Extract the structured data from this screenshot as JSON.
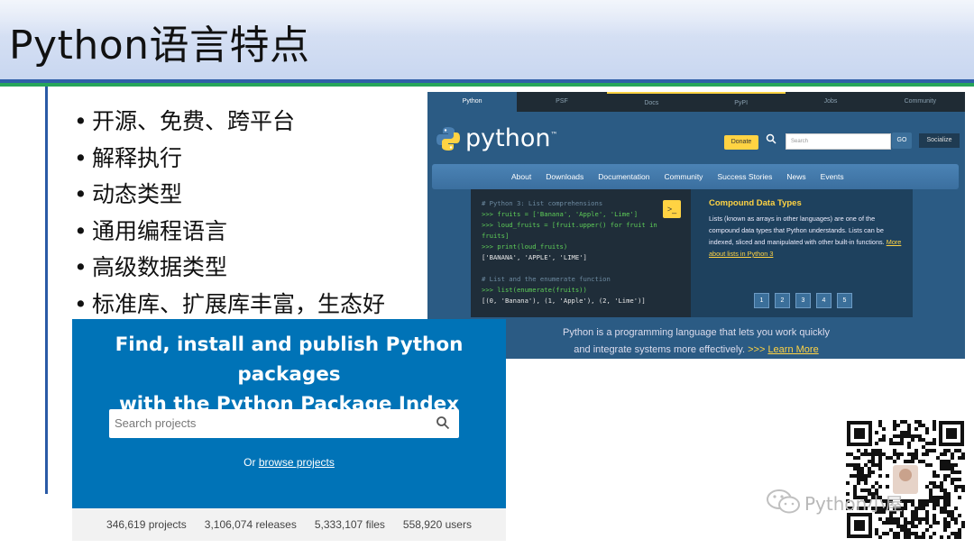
{
  "slide": {
    "title": "Python语言特点",
    "bullets": [
      "开源、免费、跨平台",
      "解释执行",
      "动态类型",
      "通用编程语言",
      "高级数据类型",
      "标准库、扩展库丰富，生态好"
    ],
    "bullet_char": "•"
  },
  "python_org": {
    "top_tabs": [
      "Python",
      "PSF",
      "Docs",
      "PyPI",
      "Jobs",
      "Community"
    ],
    "logo_text": "python",
    "logo_tm": "™",
    "donate_label": "Donate",
    "search_placeholder": "Search",
    "go_label": "GO",
    "socialize_label": "Socialize",
    "main_nav": [
      "About",
      "Downloads",
      "Documentation",
      "Community",
      "Success Stories",
      "News",
      "Events"
    ],
    "shell": {
      "comment1": "# Python 3: List comprehensions",
      "line1": ">>> fruits = ['Banana', 'Apple', 'Lime']",
      "line2": ">>> loud_fruits = [fruit.upper() for fruit in",
      "line2b": "fruits]",
      "line3": ">>> print(loud_fruits)",
      "out1": "['BANANA', 'APPLE', 'LIME']",
      "comment2": "# List and the enumerate function",
      "line4": ">>> list(enumerate(fruits))",
      "out2": "[(0, 'Banana'), (1, 'Apple'), (2, 'Lime')]",
      "run_label": ">_"
    },
    "info_title": "Compound Data Types",
    "info_body": "Lists (known as arrays in other languages) are one of the compound data types that Python understands. Lists can be indexed, sliced and manipulated with other built-in functions.",
    "info_link": "More about lists in Python 3",
    "pager": [
      "1",
      "2",
      "3",
      "4",
      "5"
    ],
    "tagline1": "Python is a programming language that lets you work quickly",
    "tagline2": "and integrate systems more effectively.",
    "learn_more_arrows": ">>>",
    "learn_more": "Learn More"
  },
  "pypi": {
    "heading_line1": "Find, install and publish Python packages",
    "heading_line2": "with the Python Package Index",
    "search_placeholder": "Search projects",
    "or_text": "Or",
    "browse_link": "browse projects",
    "stats": [
      "346,619 projects",
      "3,106,074 releases",
      "5,333,107 files",
      "558,920 users"
    ]
  },
  "watermark": {
    "text": "Python小屋",
    "icon": "wechat-icon"
  },
  "colors": {
    "title_band": "#c8d6f0",
    "rule_blue": "#2f5fa8",
    "rule_green": "#27a55a",
    "python_blue": "#2b5b84",
    "python_yellow": "#ffd343",
    "pypi_blue": "#0073b7"
  }
}
